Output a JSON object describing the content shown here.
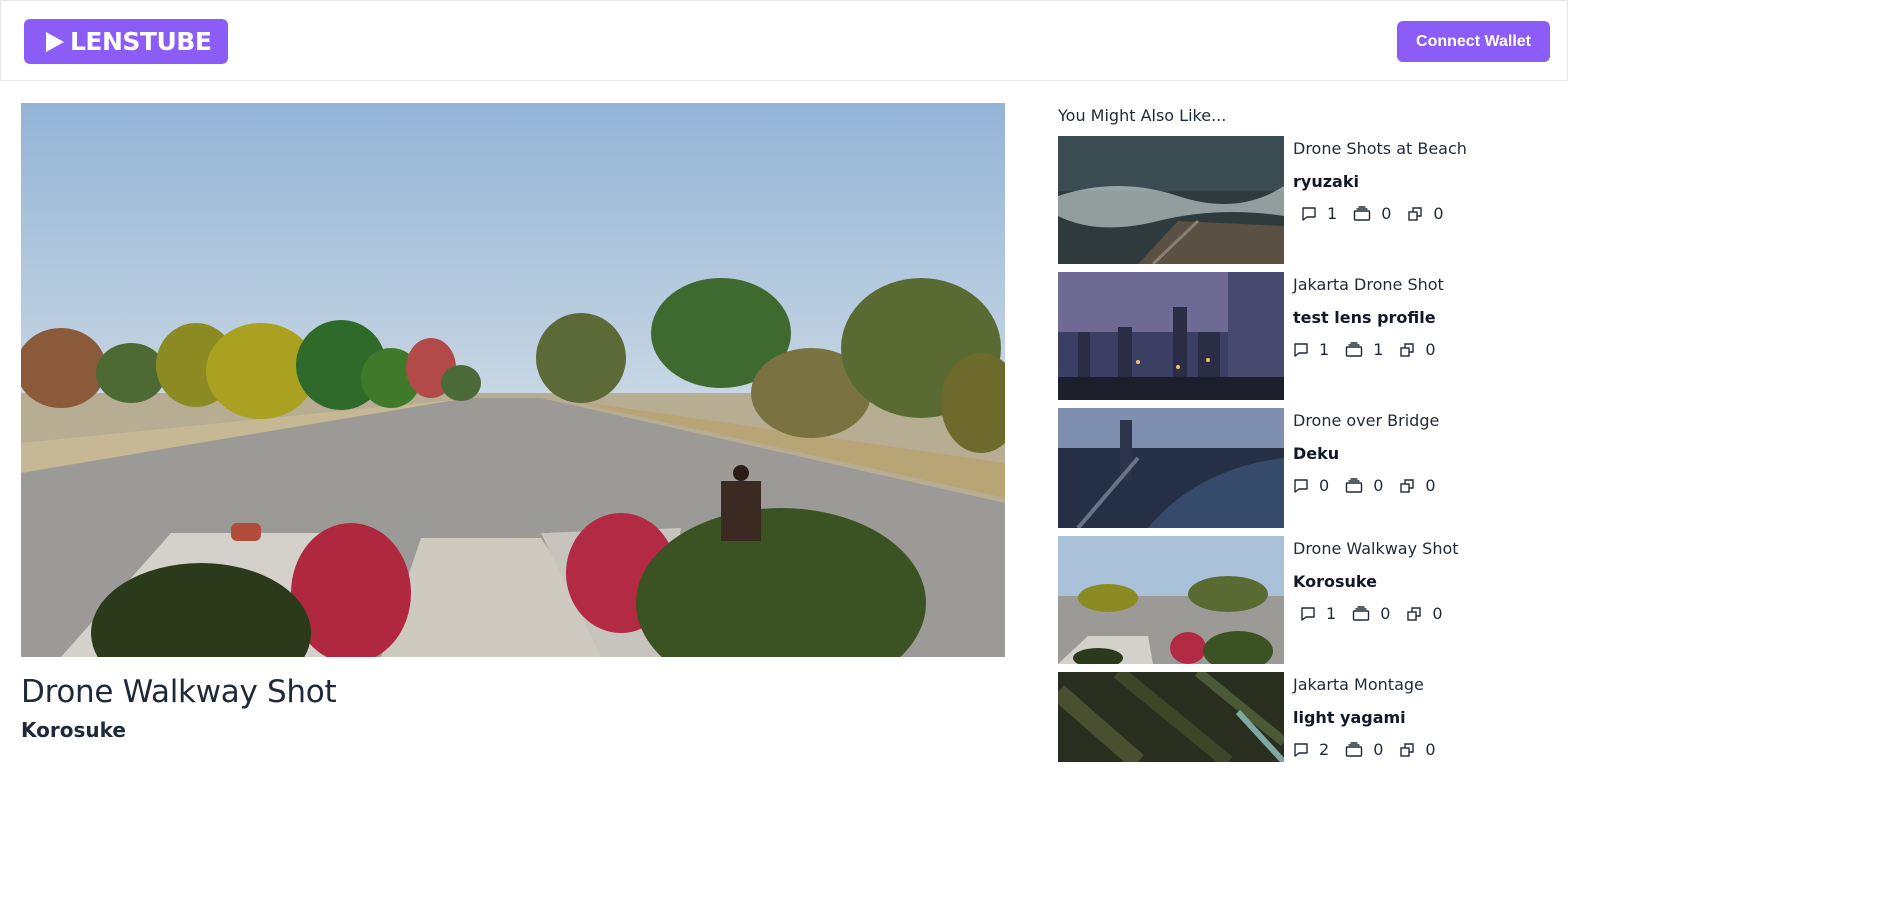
{
  "header": {
    "logo_text": "LENSTUBE",
    "connect_label": "Connect Wallet",
    "accent": "#8b5cf6"
  },
  "video": {
    "title": "Drone Walkway Shot",
    "author": "Korosuke"
  },
  "sidebar": {
    "heading": "You Might Also Like...",
    "items": [
      {
        "title": "Drone Shots at Beach",
        "author": "ryuzaki",
        "comments": "1",
        "collects": "0",
        "mirrors": "0"
      },
      {
        "title": "Jakarta Drone Shot",
        "author": "test lens profile",
        "comments": "1",
        "collects": "1",
        "mirrors": "0"
      },
      {
        "title": "Drone over Bridge",
        "author": "Deku",
        "comments": "0",
        "collects": "0",
        "mirrors": "0"
      },
      {
        "title": "Drone Walkway Shot",
        "author": "Korosuke",
        "comments": "1",
        "collects": "0",
        "mirrors": "0"
      },
      {
        "title": "Jakarta Montage",
        "author": "light yagami",
        "comments": "2",
        "collects": "0",
        "mirrors": "0"
      }
    ]
  },
  "icons": {
    "comment": "comment-icon",
    "collect": "collect-icon",
    "mirror": "mirror-icon",
    "play": "play-icon"
  }
}
